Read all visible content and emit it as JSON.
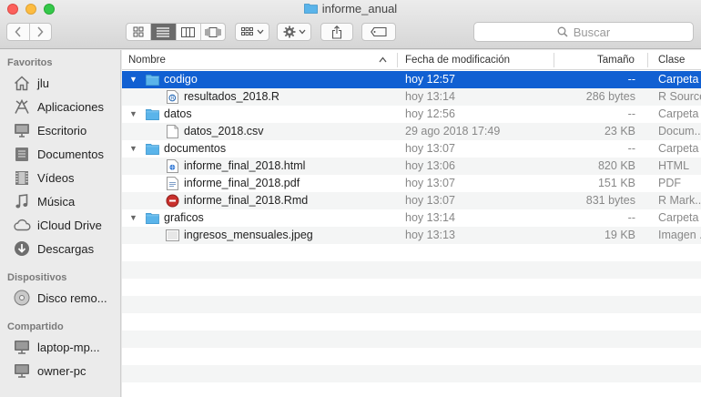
{
  "window": {
    "title": "informe_anual"
  },
  "toolbar": {
    "back_icon": "chevron-left-icon",
    "forward_icon": "chevron-right-icon",
    "search_placeholder": "Buscar"
  },
  "sidebar": {
    "sections": [
      {
        "title": "Favoritos",
        "items": [
          {
            "label": "jlu",
            "icon": "home-icon"
          },
          {
            "label": "Aplicaciones",
            "icon": "applications-icon"
          },
          {
            "label": "Escritorio",
            "icon": "desktop-icon"
          },
          {
            "label": "Documentos",
            "icon": "documents-icon"
          },
          {
            "label": "Vídeos",
            "icon": "movies-icon"
          },
          {
            "label": "Música",
            "icon": "music-icon"
          },
          {
            "label": "iCloud Drive",
            "icon": "cloud-icon"
          },
          {
            "label": "Descargas",
            "icon": "downloads-icon"
          }
        ]
      },
      {
        "title": "Dispositivos",
        "items": [
          {
            "label": "Disco remo...",
            "icon": "disc-icon"
          }
        ]
      },
      {
        "title": "Compartido",
        "items": [
          {
            "label": "laptop-mp...",
            "icon": "computer-icon"
          },
          {
            "label": "owner-pc",
            "icon": "computer-icon"
          }
        ]
      }
    ]
  },
  "columns": {
    "name": "Nombre",
    "date": "Fecha de modificación",
    "size": "Tamaño",
    "kind": "Clase"
  },
  "rows": [
    {
      "name": "codigo",
      "date": "hoy 12:57",
      "size": "--",
      "kind": "Carpeta",
      "type": "folder",
      "level": 0,
      "expanded": true,
      "selected": true
    },
    {
      "name": "resultados_2018.R",
      "date": "hoy 13:14",
      "size": "286 bytes",
      "kind": "R Source",
      "type": "r-file",
      "level": 1
    },
    {
      "name": "datos",
      "date": "hoy 12:56",
      "size": "--",
      "kind": "Carpeta",
      "type": "folder",
      "level": 0,
      "expanded": true
    },
    {
      "name": "datos_2018.csv",
      "date": "29 ago 2018 17:49",
      "size": "23 KB",
      "kind": "Docum...",
      "type": "doc-file",
      "level": 1
    },
    {
      "name": "documentos",
      "date": "hoy 13:07",
      "size": "--",
      "kind": "Carpeta",
      "type": "folder",
      "level": 0,
      "expanded": true
    },
    {
      "name": "informe_final_2018.html",
      "date": "hoy 13:06",
      "size": "820 KB",
      "kind": "HTML",
      "type": "html-file",
      "level": 1
    },
    {
      "name": "informe_final_2018.pdf",
      "date": "hoy 13:07",
      "size": "151 KB",
      "kind": "PDF",
      "type": "pdf-file",
      "level": 1
    },
    {
      "name": "informe_final_2018.Rmd",
      "date": "hoy 13:07",
      "size": "831 bytes",
      "kind": "R Mark...",
      "type": "rmd-file",
      "level": 1
    },
    {
      "name": "graficos",
      "date": "hoy 13:14",
      "size": "--",
      "kind": "Carpeta",
      "type": "folder",
      "level": 0,
      "expanded": true
    },
    {
      "name": "ingresos_mensuales.jpeg",
      "date": "hoy 13:13",
      "size": "19 KB",
      "kind": "Imagen ...",
      "type": "image-file",
      "level": 1
    }
  ],
  "colors": {
    "selection": "#1160d2",
    "folder": "#5ab4ea"
  }
}
